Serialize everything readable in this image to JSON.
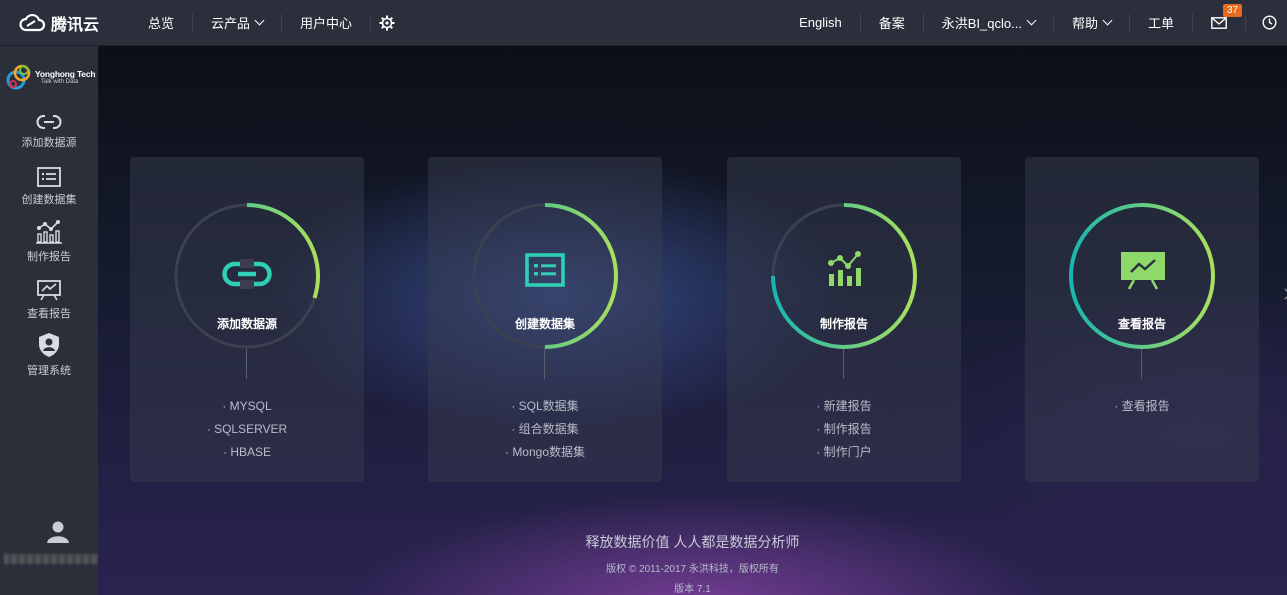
{
  "header": {
    "brand": "腾讯云",
    "nav": [
      "总览",
      "云产品",
      "用户中心"
    ],
    "right": {
      "lang": "English",
      "record": "备案",
      "account": "永洪BI_qclo...",
      "help": "帮助",
      "ticket": "工单",
      "mail_count": "37"
    }
  },
  "sidebar": {
    "brand_name": "Yonghong Tech",
    "brand_tagline": "Talk with Data",
    "items": [
      {
        "label": "添加数据源",
        "icon": "link-icon"
      },
      {
        "label": "创建数据集",
        "icon": "dataset-icon"
      },
      {
        "label": "制作报告",
        "icon": "chart-icon"
      },
      {
        "label": "查看报告",
        "icon": "presentation-icon"
      },
      {
        "label": "管理系统",
        "icon": "shield-user-icon"
      }
    ]
  },
  "cards": [
    {
      "title": "添加数据源",
      "links": [
        "· MYSQL",
        "· SQLSERVER",
        "· HBASE"
      ],
      "progress": 0.3
    },
    {
      "title": "创建数据集",
      "links": [
        "· SQL数据集",
        "· 组合数据集",
        "· Mongo数据集"
      ],
      "progress": 0.5
    },
    {
      "title": "制作报告",
      "links": [
        "· 新建报告",
        "· 制作报告",
        "· 制作门户"
      ],
      "progress": 0.75
    },
    {
      "title": "查看报告",
      "links": [
        "· 查看报告"
      ],
      "progress": 1.0
    }
  ],
  "footer": {
    "slogan": "释放数据价值 人人都是数据分析师",
    "copyright": "版权 © 2011-2017 永洪科技，版权所有",
    "version": "版本 7.1"
  },
  "colors": {
    "accent_start": "#19b6b0",
    "accent_end": "#a9e05c",
    "topbar": "#2a2f3b",
    "sidebar": "#2b2f3a"
  }
}
